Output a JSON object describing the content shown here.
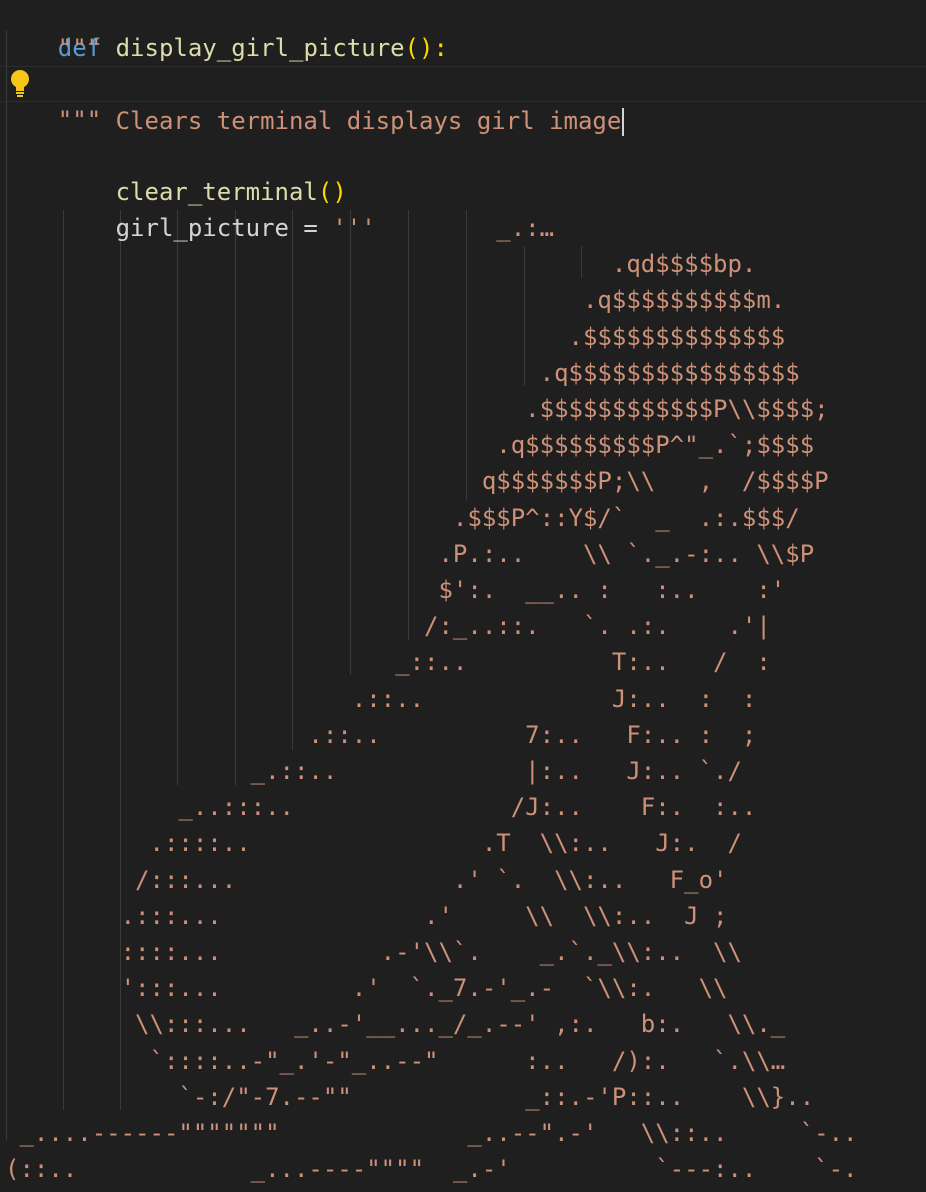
{
  "editor": {
    "lines": [
      {
        "kw": "def",
        "fn": "display_girl_picture",
        "par": "():",
        "text": ""
      },
      {
        "text": "    \"\"\""
      },
      {
        "text": "    Clears terminal displays girl image"
      },
      {
        "text": "    \"\"\""
      },
      {
        "fn": "clear_terminal",
        "par": "()",
        "text": "    "
      },
      {
        "var": "girl_picture = ",
        "str": "'''",
        "text": "    "
      }
    ],
    "art_lines": [
      "                                  _.:…",
      "                                          .qd$$$$bp.",
      "                                        .q$$$$$$$$$$m.",
      "                                       .$$$$$$$$$$$$$$",
      "                                     .q$$$$$$$$$$$$$$$$",
      "                                    .$$$$$$$$$$$$P\\\\$$$$;",
      "                                  .q$$$$$$$$$P^\"_.`;$$$$",
      "                                 q$$$$$$$P;\\\\   ,  /$$$$P",
      "                               .$$$P^::Y$/`  _  .:.$$$/",
      "                              .P.:..    \\\\ `._.-:.. \\\\$P",
      "                              $':.  __.. :   :..    :'",
      "                             /:_..::.   `. .:.    .'|",
      "                           _::..          T:..   /  :",
      "                        .::..             J:..  :  :",
      "                     .::..          7:..   F:.. :  ;",
      "                 _.::..             |:..   J:.. `./",
      "            _..:::..               /J:..    F:.  :..",
      "          .::::..                .T  \\\\:..   J:.  /",
      "         /:::...               .' `.  \\\\:..   F_o'",
      "        .:::...              .'     \\\\  \\\\:..  J ;",
      "        ::::...           .-'\\\\`.    _.`._\\\\:..  \\\\",
      "        ':::...         .'  `._7.-'_.-  `\\\\:.   \\\\",
      "         \\\\:::...   _..-'__..._/_.--' ,:.   b:.   \\\\._",
      "          `::::..-\"_.'-\"_..--\"      :..   /):.   `.\\\\…",
      "            `-:/\"-7.--\"\"            _::.-'P::..    \\\\}..",
      " _....------\"\"\"\"\"\"\"             _..--\".-'   \\\\::..     `-..",
      "(::..            _...----\"\"\"\"  _.-'          `---:..    `-."
    ]
  },
  "colors": {
    "background": "#1f1f1f",
    "keyword": "#569cd6",
    "function": "#dcdcaa",
    "bracket": "#ffd700",
    "string": "#ce9178",
    "variable": "#d4d4d4",
    "bulb": "#f5c518"
  },
  "icons": {
    "hint": "lightbulb-icon"
  }
}
